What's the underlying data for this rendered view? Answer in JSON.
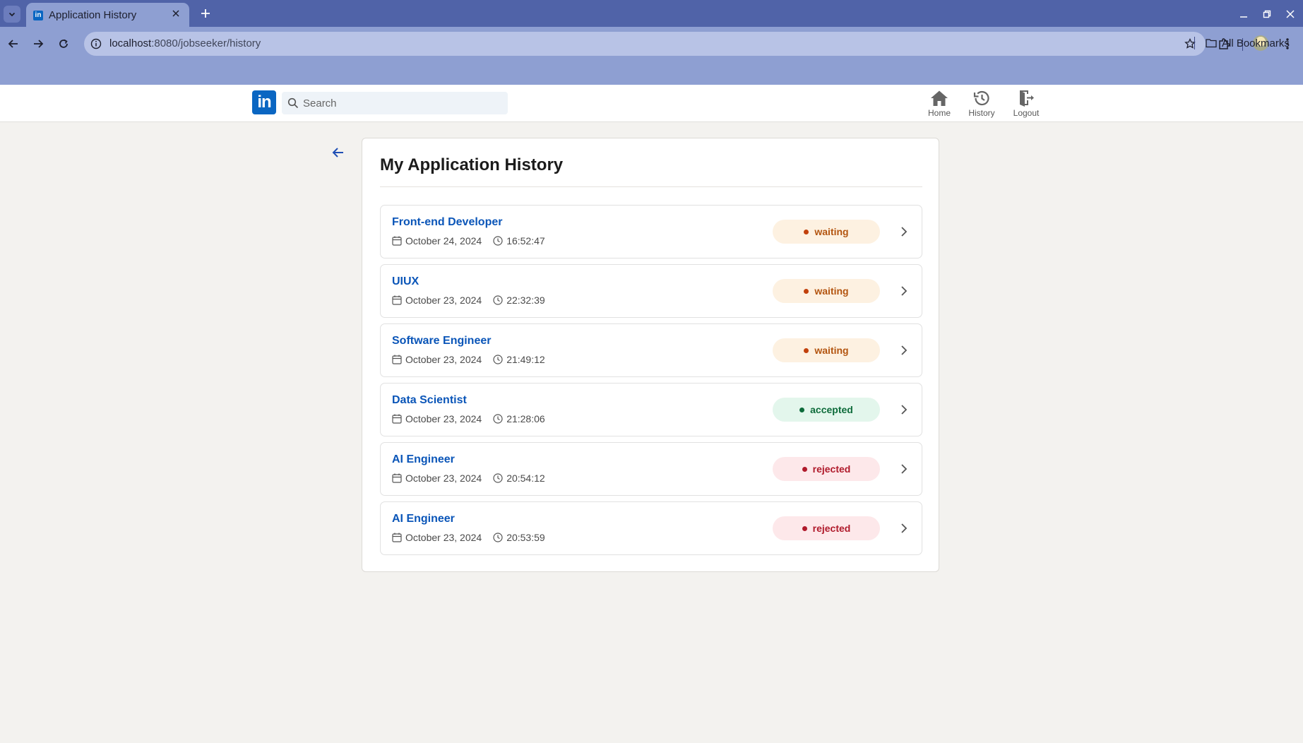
{
  "browser": {
    "tab_title": "Application History",
    "url_host": "localhost",
    "url_rest": ":8080/jobseeker/history",
    "bookmarks_label": "All Bookmarks"
  },
  "header": {
    "logo_text": "in",
    "search_placeholder": "Search",
    "nav": [
      {
        "label": "Home",
        "icon": "home-icon"
      },
      {
        "label": "History",
        "icon": "history-icon"
      },
      {
        "label": "Logout",
        "icon": "logout-icon"
      }
    ]
  },
  "page": {
    "title": "My Application History"
  },
  "status_colors": {
    "waiting": {
      "bg": "#fdf1e1",
      "fg": "#b35510",
      "dot": "#c2410c"
    },
    "accepted": {
      "bg": "#e3f6ec",
      "fg": "#0d6b3a",
      "dot": "#0d6b3a"
    },
    "rejected": {
      "bg": "#fde8ea",
      "fg": "#b01a2b",
      "dot": "#b01a2b"
    }
  },
  "applications": [
    {
      "title": "Front-end Developer",
      "date": "October 24, 2024",
      "time": "16:52:47",
      "status": "waiting"
    },
    {
      "title": "UIUX",
      "date": "October 23, 2024",
      "time": "22:32:39",
      "status": "waiting"
    },
    {
      "title": "Software Engineer",
      "date": "October 23, 2024",
      "time": "21:49:12",
      "status": "waiting"
    },
    {
      "title": "Data Scientist",
      "date": "October 23, 2024",
      "time": "21:28:06",
      "status": "accepted"
    },
    {
      "title": "AI Engineer",
      "date": "October 23, 2024",
      "time": "20:54:12",
      "status": "rejected"
    },
    {
      "title": "AI Engineer",
      "date": "October 23, 2024",
      "time": "20:53:59",
      "status": "rejected"
    }
  ]
}
